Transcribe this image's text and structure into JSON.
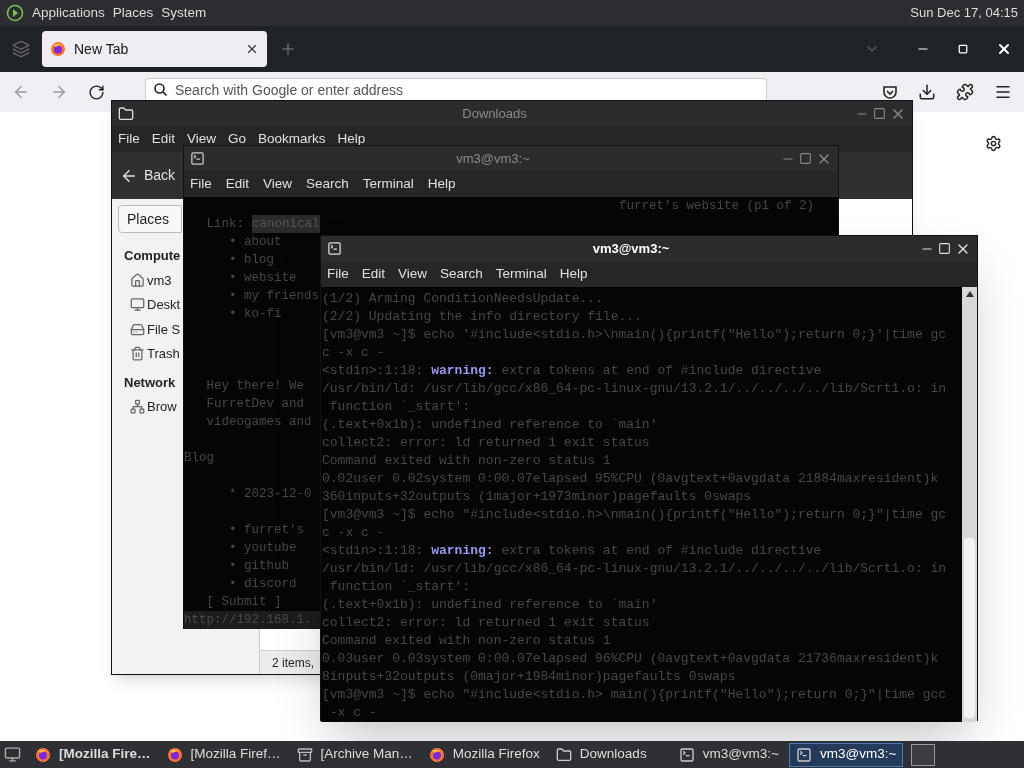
{
  "top_panel": {
    "menus": [
      "Applications",
      "Places",
      "System"
    ],
    "clock": "Sun Dec 17, 04:15"
  },
  "browser": {
    "tabs": [
      {
        "label": "New Tab",
        "selected": true
      }
    ],
    "address_bar": {
      "placeholder": "Search with Google or enter address"
    }
  },
  "file_manager": {
    "title": "Downloads",
    "focused": false,
    "menus": [
      "File",
      "Edit",
      "View",
      "Go",
      "Bookmarks",
      "Help"
    ],
    "back_button": "Back",
    "places_selector": "Places",
    "sidebar": [
      {
        "kind": "header",
        "label": "Compute"
      },
      {
        "kind": "place",
        "label": "vm3"
      },
      {
        "kind": "place",
        "label": "Deskt"
      },
      {
        "kind": "place",
        "label": "File S"
      },
      {
        "kind": "place",
        "label": "Trash"
      },
      {
        "kind": "header",
        "label": "Network"
      },
      {
        "kind": "place",
        "label": "Brow"
      }
    ],
    "status": "2 items,"
  },
  "back_terminal": {
    "title": "vm3@vm3:~",
    "focused": false,
    "menus": [
      "File",
      "Edit",
      "View",
      "Search",
      "Terminal",
      "Help"
    ],
    "page_title": "furret's website (p1 of 2)",
    "lines": [
      {
        "kind": "link",
        "label": "   Link:",
        "value": "canonical"
      },
      {
        "kind": "text",
        "text": "      • about"
      },
      {
        "kind": "text",
        "text": "      • blog"
      },
      {
        "kind": "text",
        "text": "      • website"
      },
      {
        "kind": "text",
        "text": "      • my friends"
      },
      {
        "kind": "text",
        "text": "      • ko-fi"
      },
      {
        "kind": "blank"
      },
      {
        "kind": "blank"
      },
      {
        "kind": "blank"
      },
      {
        "kind": "text",
        "text": "   Hey there! We"
      },
      {
        "kind": "text",
        "text": "   FurretDev and"
      },
      {
        "kind": "text",
        "text": "   videogames and"
      },
      {
        "kind": "blank"
      },
      {
        "kind": "text",
        "text": "Blog"
      },
      {
        "kind": "blank"
      },
      {
        "kind": "text",
        "text": "      * 2023-12-0"
      },
      {
        "kind": "blank"
      },
      {
        "kind": "text",
        "text": "      • furret's"
      },
      {
        "kind": "text",
        "text": "      • youtube"
      },
      {
        "kind": "text",
        "text": "      • github"
      },
      {
        "kind": "text",
        "text": "      • discord"
      },
      {
        "kind": "text",
        "text": "   [ Submit ]"
      }
    ],
    "status_line": "http://192.168.1."
  },
  "front_terminal": {
    "title": "vm3@vm3:~",
    "focused": true,
    "menus": [
      "File",
      "Edit",
      "View",
      "Search",
      "Terminal",
      "Help"
    ],
    "lines": [
      "(1/2) Arming ConditionNeedsUpdate...",
      "(2/2) Updating the info directory file...",
      "[vm3@vm3 ~]$ echo '#include<stdio.h>\\nmain(){printf(\"Hello\");return 0;}'|time gc",
      "c -x c -",
      "<stdin>:1:18: **warning:** extra tokens at end of #include directive",
      "/usr/bin/ld: /usr/lib/gcc/x86_64-pc-linux-gnu/13.2.1/../../../../lib/Scrt1.o: in",
      " function `_start':",
      "(.text+0x1b): undefined reference to `main'",
      "collect2: error: ld returned 1 exit status",
      "Command exited with non-zero status 1",
      "0.02user 0.02system 0:00.07elapsed 95%CPU (0avgtext+0avgdata 21884maxresident)k",
      "360inputs+32outputs (1major+1973minor)pagefaults 0swaps",
      "[vm3@vm3 ~]$ echo \"#include<stdio.h>\\nmain(){printf(\"Hello\");return 0;}\"|time gc",
      "c -x c -",
      "<stdin>:1:18: **warning:** extra tokens at end of #include directive",
      "/usr/bin/ld: /usr/lib/gcc/x86_64-pc-linux-gnu/13.2.1/../../../../lib/Scrt1.o: in",
      " function `_start':",
      "(.text+0x1b): undefined reference to `main'",
      "collect2: error: ld returned 1 exit status",
      "Command exited with non-zero status 1",
      "0.03user 0.03system 0:00.07elapsed 96%CPU (0avgtext+0avgdata 21736maxresident)k",
      "8inputs+32outputs (0major+1984minor)pagefaults 0swaps",
      "[vm3@vm3 ~]$ echo \"#include<stdio.h> main(){printf(\"Hello\");return 0;}\"|time gcc",
      " -x c -"
    ]
  },
  "taskbar": {
    "items": [
      {
        "label": "[Mozilla Fire…",
        "selected": false
      },
      {
        "label": "[Mozilla Firef…",
        "selected": false
      },
      {
        "label": "[Archive Man…",
        "selected": false
      },
      {
        "label": "Mozilla Firefox",
        "selected": false
      },
      {
        "label": "Downloads",
        "selected": false
      },
      {
        "label": "vm3@vm3:~",
        "selected": false
      },
      {
        "label": "vm3@vm3:~",
        "selected": true
      }
    ]
  }
}
